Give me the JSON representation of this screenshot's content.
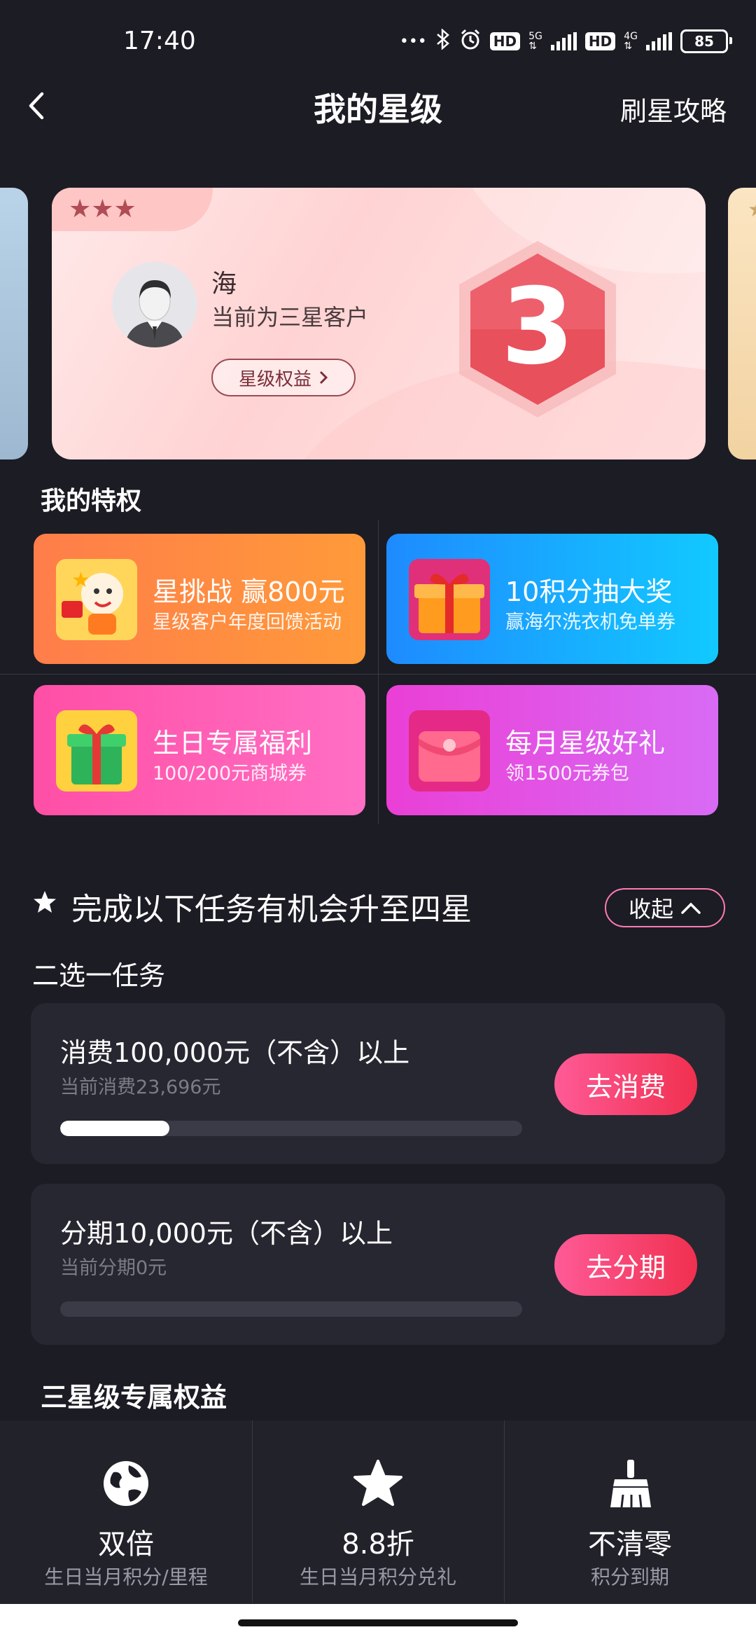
{
  "status_bar": {
    "time": "17:40",
    "net1": "5G",
    "net2": "4G",
    "hd": "HD",
    "battery": "85"
  },
  "header": {
    "title": "我的星级",
    "right_link": "刷星攻略"
  },
  "level_card": {
    "stars": "★★★",
    "user_name": "海",
    "level_text": "当前为三星客户",
    "benefit_button": "星级权益",
    "badge_number": "3"
  },
  "privileges": {
    "title": "我的特权",
    "items": [
      {
        "title": "星挑战 赢800元",
        "subtitle": "星级客户年度回馈活动"
      },
      {
        "title": "10积分抽大奖",
        "subtitle": "赢海尔洗衣机免单券"
      },
      {
        "title": "生日专属福利",
        "subtitle": "100/200元商城券"
      },
      {
        "title": "每月星级好礼",
        "subtitle": "领1500元券包"
      }
    ]
  },
  "tasks": {
    "title": "完成以下任务有机会升至四星",
    "collapse_label": "收起",
    "choose_label": "二选一任务",
    "items": [
      {
        "name": "消费100,000元（不含）以上",
        "current": "当前消费23,696元",
        "button": "去消费",
        "progress": 0.237
      },
      {
        "name": "分期10,000元（不含）以上",
        "current": "当前分期0元",
        "button": "去分期",
        "progress": 0
      }
    ]
  },
  "exclusive": {
    "title": "三星级专属权益",
    "items": [
      {
        "icon": "globe-icon",
        "name": "双倍",
        "desc": "生日当月积分/里程"
      },
      {
        "icon": "star-icon",
        "name": "8.8折",
        "desc": "生日当月积分兑礼"
      },
      {
        "icon": "broom-icon",
        "name": "不清零",
        "desc": "积分到期"
      }
    ]
  }
}
